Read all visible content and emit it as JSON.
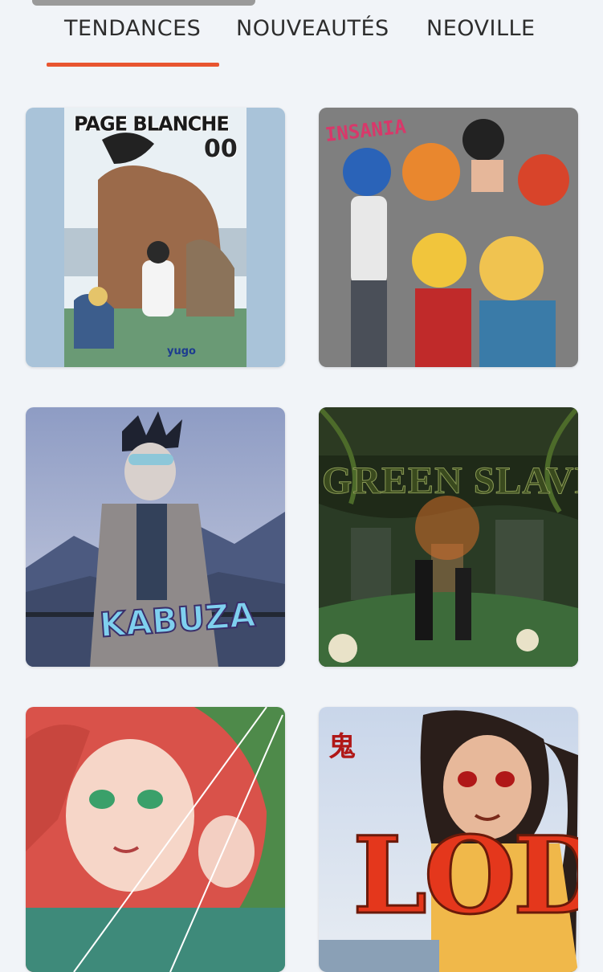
{
  "tabs": [
    {
      "label": "TENDANCES",
      "active": true
    },
    {
      "label": "NOUVEAUTÉS",
      "active": false
    },
    {
      "label": "NEOVILLE",
      "active": false
    }
  ],
  "accent_color": "#e85530",
  "covers": [
    {
      "title": "PAGE BLANCHE",
      "number": "00",
      "author": "yugo"
    },
    {
      "title": "INSANIA"
    },
    {
      "title": "KABUZA"
    },
    {
      "title": "GREEN SLAVE"
    },
    {
      "title": ""
    },
    {
      "title": "LODI",
      "kanji": "鬼"
    }
  ]
}
